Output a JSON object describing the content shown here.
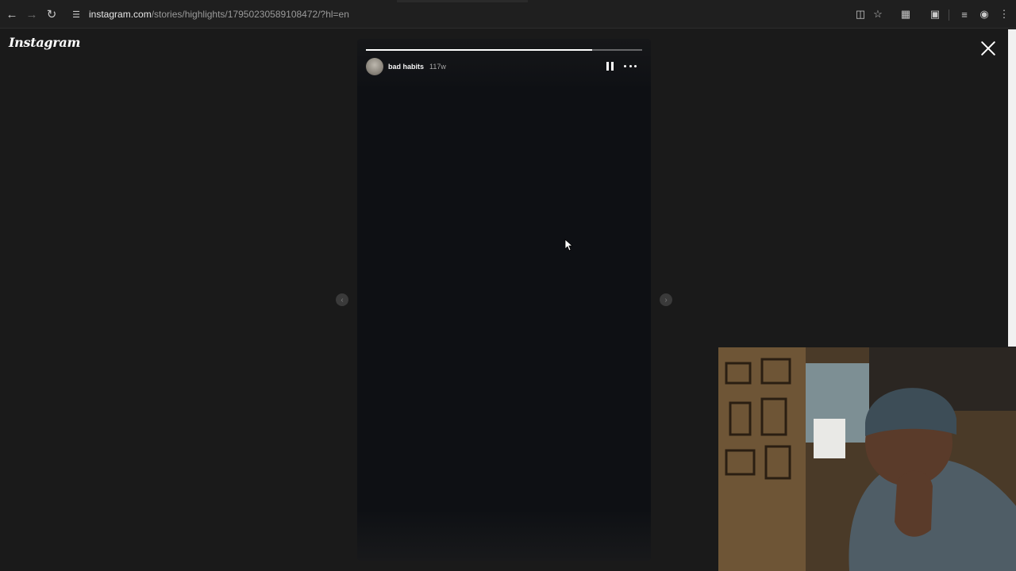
{
  "browser": {
    "url_host": "instagram.com",
    "url_path": "/stories/highlights/17950230589108472/?hl=en",
    "icons": [
      "back-arrow-icon",
      "forward-arrow-icon",
      "reload-icon",
      "site-info-icon",
      "install-app-icon",
      "star-icon",
      "extensions-icon",
      "tab-search-icon",
      "media-control-icon",
      "profile-icon",
      "menu-icon"
    ]
  },
  "instagram": {
    "logo": "Instagram",
    "story": {
      "username": "bad habits",
      "time_ago": "117w",
      "progress": 0.82
    }
  },
  "colors": {
    "page_bg": "#1a1a1a",
    "story_bg": "#0e1014",
    "browser_bg": "#1f1f1f"
  }
}
